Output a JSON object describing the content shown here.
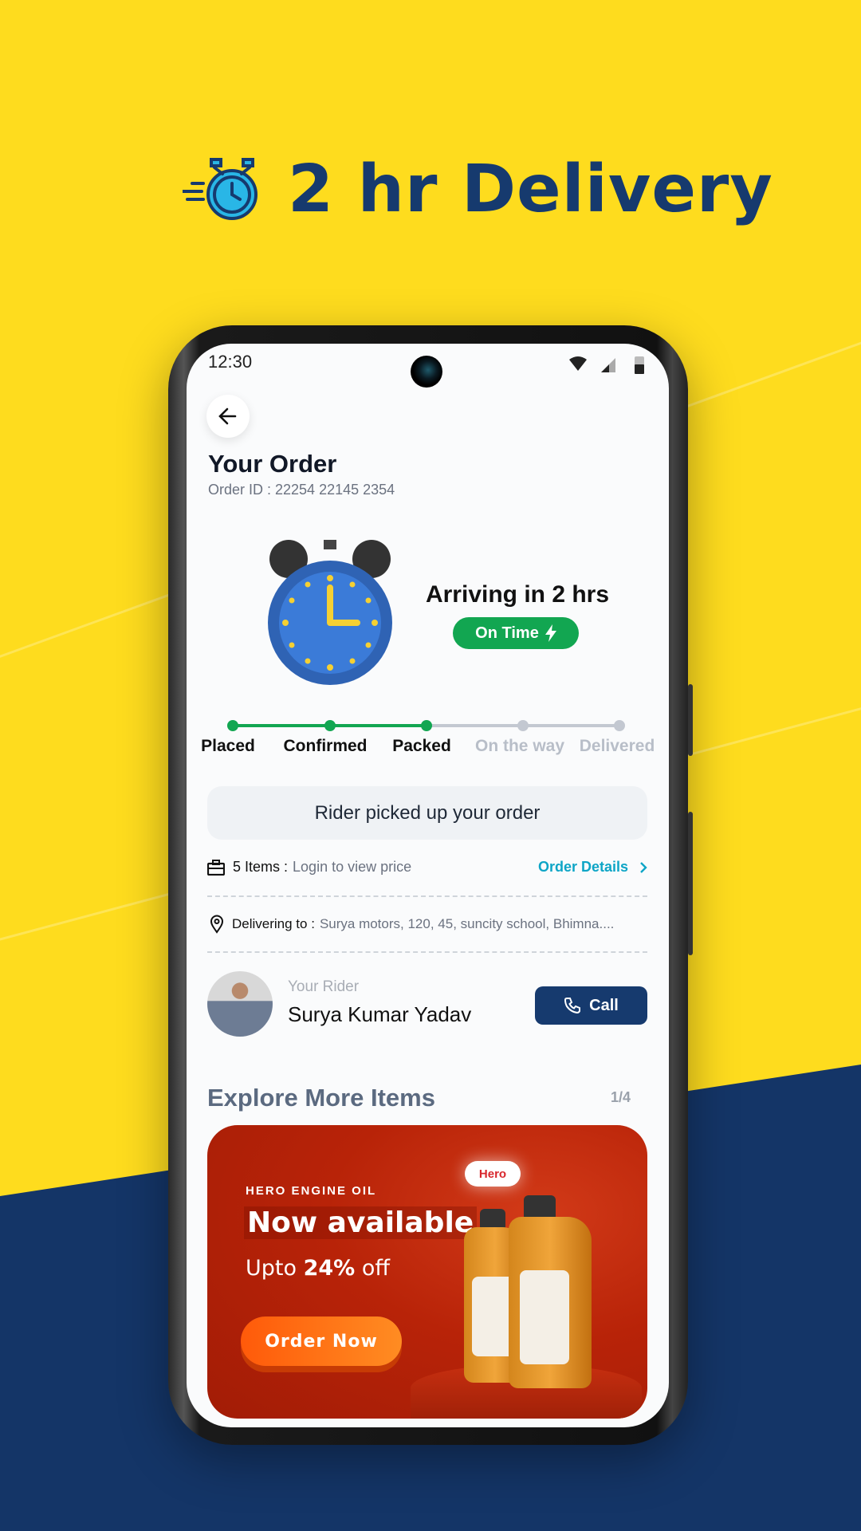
{
  "promo": {
    "headline": "2 hr Delivery",
    "icon": "stopwatch-icon"
  },
  "status_bar": {
    "time": "12:30"
  },
  "order": {
    "title": "Your Order",
    "order_id": "Order ID : 22254 22145 2354",
    "arrival": "Arriving in 2 hrs",
    "badge": "On Time",
    "badge_color": "#12a651"
  },
  "progress": {
    "steps": [
      {
        "label": "Placed",
        "done": true
      },
      {
        "label": "Confirmed",
        "done": true
      },
      {
        "label": "Packed",
        "done": true
      },
      {
        "label": "On the way",
        "done": false
      },
      {
        "label": "Delivered",
        "done": false
      }
    ],
    "done_color": "#12a651",
    "pending_color": "#c3c8d1"
  },
  "status_message": "Rider picked up your order",
  "items": {
    "count": "5 Items :",
    "price_note": "Login to view price",
    "details_link": "Order Details"
  },
  "delivery": {
    "label": "Delivering to :",
    "address": "Surya motors, 120, 45, suncity school, Bhimna...."
  },
  "rider": {
    "caption": "Your Rider",
    "name": "Surya Kumar Yadav",
    "call_label": "Call"
  },
  "explore": {
    "title": "Explore More Items",
    "pager": "1/4"
  },
  "banner": {
    "kicker": "HERO ENGINE OIL",
    "headline": "Now available",
    "sub_prefix": "Upto ",
    "sub_bold": "24%",
    "sub_suffix": " off",
    "cta": "Order Now",
    "brand": "Hero"
  },
  "colors": {
    "yellow": "#fedc1e",
    "navy": "#163a6e",
    "accent_link": "#0ea5c6"
  }
}
